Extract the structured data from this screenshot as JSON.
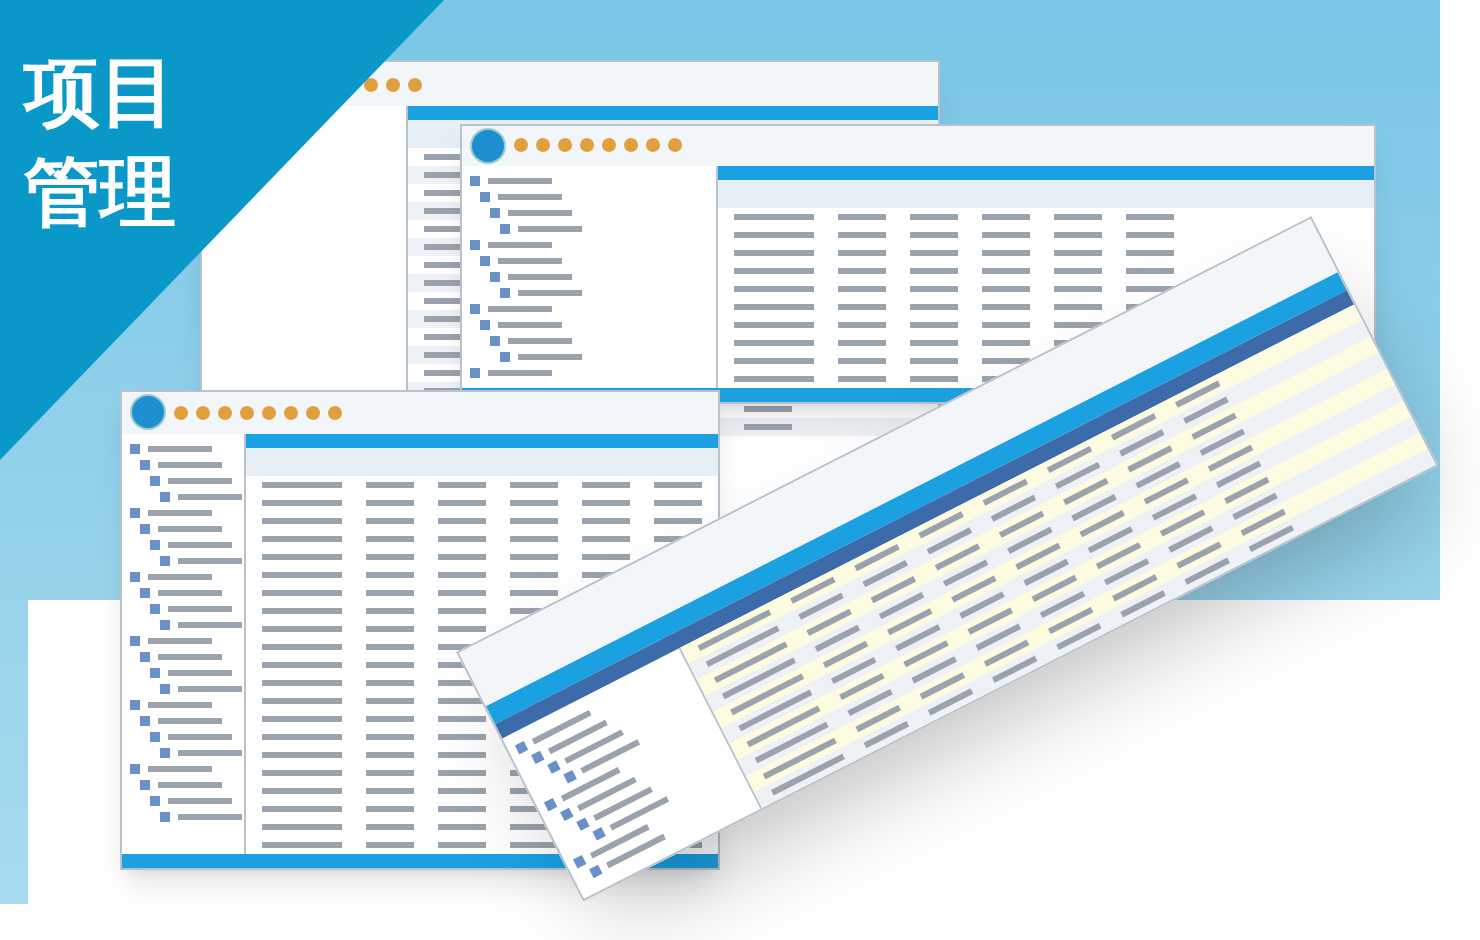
{
  "banner": {
    "title_lines": [
      "项目",
      "管理"
    ]
  }
}
